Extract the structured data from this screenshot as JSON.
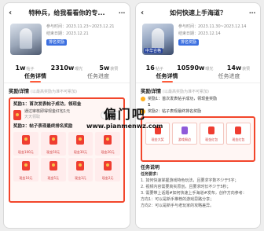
{
  "left": {
    "title": "特种兵，给我看看你的专...",
    "meta_1": "参与时间：2023.11.23~2023.12.21",
    "meta_2": "结束日期：2023.12.21",
    "badge": "排名奖励",
    "stats": [
      {
        "num": "1w",
        "label": "帖子"
      },
      {
        "num": "2310w",
        "label": "曝光"
      },
      {
        "num": "5w",
        "label": "获赞"
      }
    ],
    "tabs": [
      "任务详情",
      "任务进度"
    ],
    "section_title": "奖励详情",
    "section_sub": "(以最高奖励为准不可累加)",
    "step1": "奖励1：首次发表帖子成功，领现金",
    "reward1_text": "通过审核即得现金红包1元",
    "reward1_sub": "天天领取",
    "reward1_button": "待开启",
    "step2": "奖励2：帖子表现最终排名奖励",
    "grid_items": [
      "现金100元",
      "现金50元",
      "现金30元",
      "现金20元",
      "现金10元",
      "现金5元",
      "现金3元",
      "现金2元"
    ]
  },
  "right": {
    "title": "如何快速上手海道？",
    "meta_1": "参与时间：2023.11.30~2023.12.14",
    "meta_2": "结束日期：2023.12.14",
    "badge": "排名奖励",
    "thumb_tag": "中华合格",
    "stats": [
      {
        "num": "16",
        "label": "帖子"
      },
      {
        "num": "10590w",
        "label": "曝光"
      },
      {
        "num": "14w",
        "label": "获赞"
      }
    ],
    "tabs": [
      "任务详情",
      "任务进度"
    ],
    "section_title": "奖励详情",
    "section_sub": "(以最高奖励为准不可累加)",
    "step1": "奖励1：首次发表帖子成功，领现金奖励",
    "step1_count": "1",
    "step2": "奖励2：帖子表现最终排名奖励",
    "grid_items": [
      "现金大奖",
      "游戏周边",
      "现金红包",
      "现金红包"
    ],
    "rules_title": "任务说明",
    "rules_lines": [
      "任务要求：",
      "1. 如何快速掌握游戏特色玩法，且要求字数不少于5字；",
      "2. 视频内容需要真实原创，且要求时长不少于5秒；",
      "3. 需要带上话题#如何快速上手海道#发布，创作方向参考：",
      "方向1：可以是新手推荐的游戏思路分享；",
      "方向2：可以是新手与老玩家的攻略差异。"
    ]
  },
  "watermark": {
    "line1": "偏门吧",
    "line2": "www.pianmenwz.com"
  }
}
